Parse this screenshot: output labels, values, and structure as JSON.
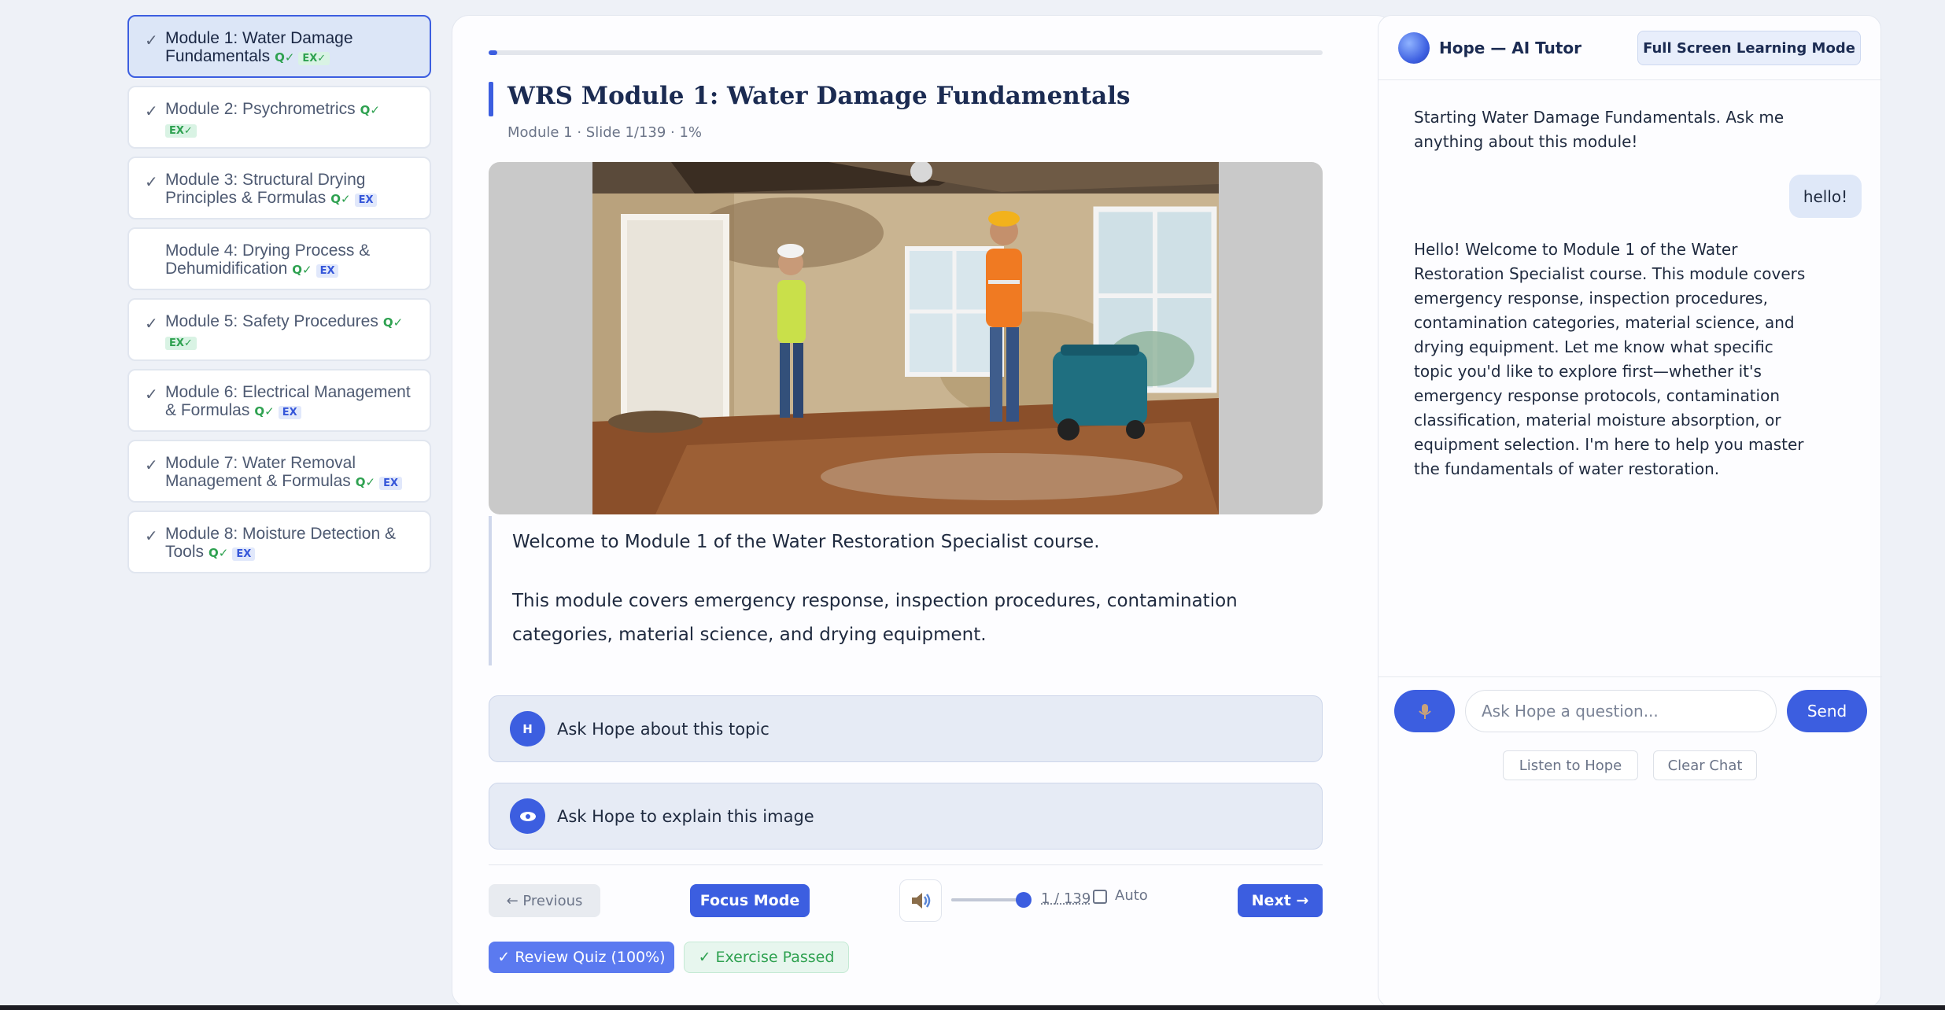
{
  "sidebar": {
    "modules": [
      {
        "title": "Module 1: Water Damage Fundamentals",
        "checked": "✓",
        "quiz": "Q✓",
        "exercise": "EX✓"
      },
      {
        "title": "Module 2: Psychrometrics",
        "checked": "✓",
        "quiz": "Q✓",
        "exercise": "EX✓"
      },
      {
        "title": "Module 3: Structural Drying Principles & Formulas",
        "checked": "✓",
        "quiz": "Q✓",
        "exercise": "EX"
      },
      {
        "title": "Module 4: Drying Process & Dehumidification",
        "checked": "",
        "quiz": "Q✓",
        "exercise": "EX"
      },
      {
        "title": "Module 5: Safety Procedures",
        "checked": "✓",
        "quiz": "Q✓",
        "exercise": "EX✓"
      },
      {
        "title": "Module 6: Electrical Management & Formulas",
        "checked": "✓",
        "quiz": "Q✓",
        "exercise": "EX"
      },
      {
        "title": "Module 7: Water Removal Management & Formulas",
        "checked": "✓",
        "quiz": "Q✓",
        "exercise": "EX"
      },
      {
        "title": "Module 8: Moisture Detection & Tools",
        "checked": "✓",
        "quiz": "Q✓",
        "exercise": "EX"
      }
    ]
  },
  "main": {
    "progress_percent": 1,
    "title": "WRS Module 1: Water Damage Fundamentals",
    "meta": "Module 1 · Slide 1/139 · 1%",
    "paragraphs": [
      "Welcome to Module 1 of the Water Restoration Specialist course.",
      "This module covers emergency response, inspection procedures, contamination categories, material science, and drying equipment."
    ],
    "ask_topic": {
      "avatar": "H",
      "label": "Ask Hope about this topic"
    },
    "ask_image": {
      "label": "Ask Hope to explain this image"
    },
    "controls": {
      "previous": "← Previous",
      "focus": "Focus Mode",
      "counter": "1 / 139",
      "auto": "Auto",
      "next": "Next →",
      "slider_value": 1
    },
    "status": {
      "quiz": "✓ Review Quiz (100%)",
      "exercise": "✓ Exercise Passed"
    }
  },
  "tutor": {
    "name": "Hope — AI Tutor",
    "fullscreen": "Full Screen Learning Mode",
    "messages": {
      "bot_intro": "Starting Water Damage Fundamentals. Ask me anything about this module!",
      "user": "hello!",
      "bot_reply": "Hello! Welcome to Module 1 of the Water Restoration Specialist course. This module covers emergency response, inspection procedures, contamination categories, material science, and drying equipment. Let me know what specific topic you'd like to explore first—whether it's emergency response protocols, contamination classification, material moisture absorption, or equipment selection. I'm here to help you master the fundamentals of water restoration."
    },
    "input_placeholder": "Ask Hope a question...",
    "send": "Send",
    "listen": "Listen to Hope",
    "clear": "Clear Chat"
  },
  "colors": {
    "accent": "#3c5ee0",
    "success": "#2ea150",
    "background": "#eef1f7"
  }
}
